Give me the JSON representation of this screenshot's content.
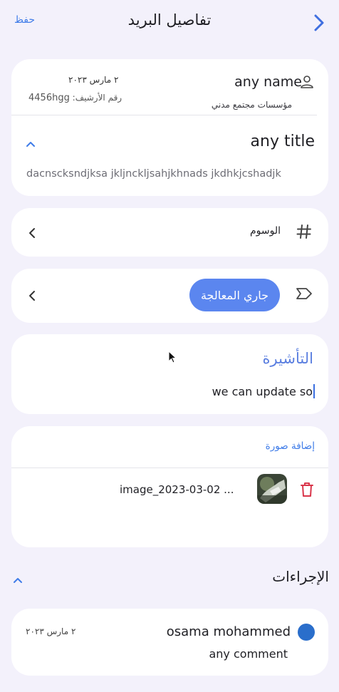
{
  "header": {
    "title": "تفاصيل البريد",
    "save_label": "حفظ",
    "back_icon": "chevron-right-icon"
  },
  "mail": {
    "sender_name": "any name",
    "organization": "مؤسسات مجتمع مدني",
    "date": "٢ مارس ٢٠٢٣",
    "archive_label": "رقم الأرشيف:",
    "archive_number": "4456hgg",
    "title": "any title",
    "body": "dacnscksndjksa jkljnckljsahjkhnads jkdhkjcshadjk"
  },
  "tags": {
    "label": "الوسوم"
  },
  "status": {
    "label": "جاري المعالجة"
  },
  "annotation": {
    "title": "التأشيرة",
    "value": "we can update so"
  },
  "attachments": {
    "add_label": "إضافة صورة",
    "files": [
      {
        "name": "image_2023-03-02 ..."
      }
    ]
  },
  "actions": {
    "title": "الإجراءات",
    "comments": [
      {
        "author": "osama mohammed",
        "date": "٢ مارس ٢٠٢٣",
        "text": "any comment"
      }
    ]
  },
  "colors": {
    "accent": "#5b86ef",
    "link": "#3f7ce8",
    "danger": "#d9364b",
    "background": "#f3f1fb",
    "avatar": "#2a6ecb"
  }
}
